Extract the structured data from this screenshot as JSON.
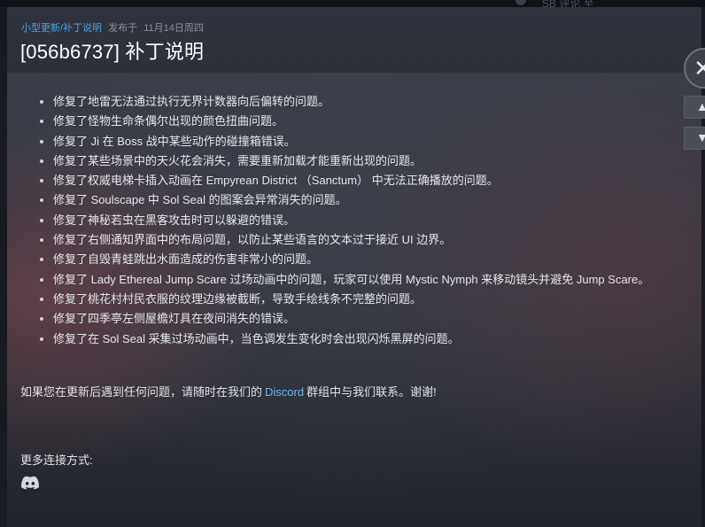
{
  "topbar": {
    "partial_text": "SB 评论 至"
  },
  "announcement": {
    "category": "小型更新/补丁说明",
    "published_prefix": "发布于",
    "published_date": "11月14日周四",
    "title": "[056b6737] 补丁说明",
    "notes": [
      "修复了地雷无法通过执行无界计数器向后偏转的问题。",
      "修复了怪物生命条偶尔出现的颜色扭曲问题。",
      "修复了 Ji 在 Boss 战中某些动作的碰撞箱错误。",
      "修复了某些场景中的天火花会消失，需要重新加载才能重新出现的问题。",
      "修复了权威电梯卡插入动画在 Empyrean District （Sanctum） 中无法正确播放的问题。",
      "修复了 Soulscape 中 Sol Seal 的图案会异常消失的问题。",
      "修复了神秘若虫在黑客攻击时可以躲避的错误。",
      "修复了右侧通知界面中的布局问题，以防止某些语言的文本过于接近 UI 边界。",
      "修复了自毁青蛙跳出水面造成的伤害非常小的问题。",
      "修复了 Lady Ethereal Jump Scare 过场动画中的问题，玩家可以使用 Mystic Nymph 来移动镜头并避免 Jump Scare。",
      "修复了桃花村村民衣服的纹理边缘被截断，导致手绘线条不完整的问题。",
      "修复了四季亭左侧屋檐灯具在夜间消失的错误。",
      "修复了在 Sol Seal 采集过场动画中，当色调发生变化时会出现闪烁黑屏的问题。"
    ],
    "footer_before": "如果您在更新后遇到任何问题，请随时在我们的",
    "footer_link": "Discord",
    "footer_after": "群组中与我们联系。谢谢!",
    "more_label": "更多连接方式:"
  },
  "icons": {
    "discord": "discord-icon",
    "close": "close-icon",
    "up": "chevron-up-icon",
    "down": "chevron-down-icon"
  },
  "colors": {
    "category": "#4fa3e0",
    "link": "#6fb8ec",
    "title": "#ffffff"
  }
}
